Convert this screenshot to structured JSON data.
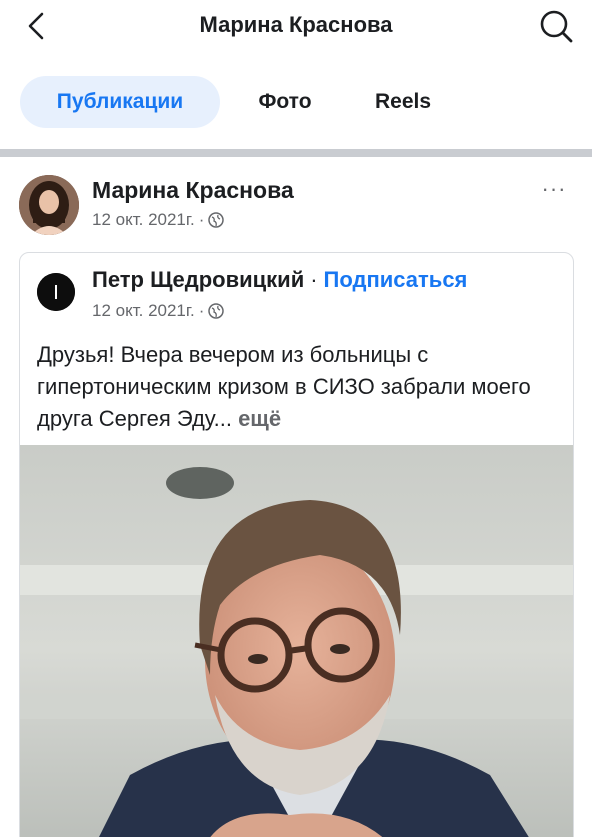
{
  "header": {
    "title": "Марина Краснова",
    "back_icon": "chevron-left-icon",
    "search_icon": "search-icon"
  },
  "tabs": [
    {
      "label": "Публикации",
      "active": true
    },
    {
      "label": "Фото",
      "active": false
    },
    {
      "label": "Reels",
      "active": false
    }
  ],
  "post": {
    "author": "Марина Краснова",
    "date": "12 окт. 2021г.",
    "separator": "·",
    "audience_icon": "globe-icon",
    "more_label": "···",
    "shared": {
      "author": "Петр Щедровицкий",
      "separator": "·",
      "follow_label": "Подписаться",
      "date": "12 окт. 2021г.",
      "text": "Друзья! Вчера вечером из больницы с гипертоническим кризом в СИЗО забрали моего друга Сергея Эду...",
      "see_more": "ещё"
    }
  },
  "colors": {
    "accent": "#1877f2",
    "active_tab_bg": "#e7f0fd",
    "secondary_text": "#65676b",
    "divider": "#c9ccd1"
  }
}
